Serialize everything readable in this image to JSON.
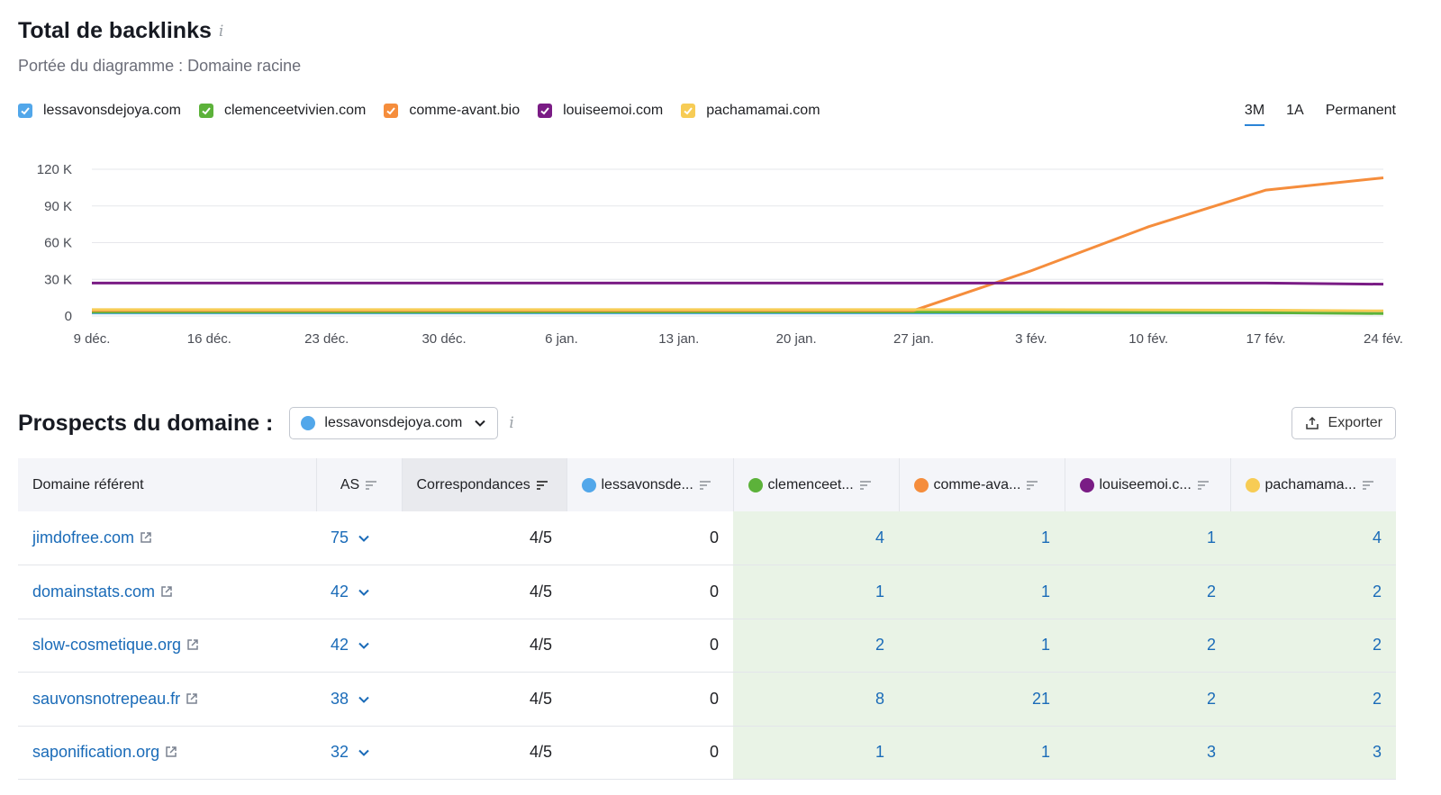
{
  "chart_section": {
    "title": "Total de backlinks",
    "info_glyph": "i",
    "subtitle": "Portée du diagramme : Domaine racine",
    "range_tabs": [
      "3M",
      "1A",
      "Permanent"
    ],
    "active_range": "3M"
  },
  "legend": [
    {
      "label": "lessavonsdejoya.com",
      "color": "#52a7ea"
    },
    {
      "label": "clemenceetvivien.com",
      "color": "#5cb23a"
    },
    {
      "label": "comme-avant.bio",
      "color": "#f58d3c"
    },
    {
      "label": "louiseemoi.com",
      "color": "#7a1c85"
    },
    {
      "label": "pachamamai.com",
      "color": "#f7cc55"
    }
  ],
  "chart_data": {
    "type": "line",
    "title": "Total de backlinks",
    "x": [
      "9 déc.",
      "16 déc.",
      "23 déc.",
      "30 déc.",
      "6 jan.",
      "13 jan.",
      "20 jan.",
      "27 jan.",
      "3 fév.",
      "10 fév.",
      "17 fév.",
      "24 fév."
    ],
    "y_ticks": [
      0,
      30000,
      60000,
      90000,
      120000
    ],
    "y_tick_labels": [
      "0",
      "30 K",
      "60 K",
      "90 K",
      "120 K"
    ],
    "ylim": [
      0,
      120000
    ],
    "grid": true,
    "series": [
      {
        "name": "lessavonsdejoya.com",
        "color": "#52a7ea",
        "values": [
          2500,
          2500,
          2500,
          2500,
          2500,
          2500,
          2500,
          2500,
          2500,
          2500,
          2500,
          2500
        ]
      },
      {
        "name": "clemenceetvivien.com",
        "color": "#5cb23a",
        "values": [
          3200,
          3200,
          3200,
          3200,
          3300,
          3300,
          3300,
          3300,
          3200,
          3000,
          2800,
          2000
        ]
      },
      {
        "name": "comme-avant.bio",
        "color": "#f58d3c",
        "values": [
          4500,
          4500,
          4500,
          4500,
          4500,
          4500,
          4500,
          4500,
          37000,
          73000,
          103000,
          113000
        ]
      },
      {
        "name": "louiseemoi.com",
        "color": "#7a1c85",
        "values": [
          27000,
          27000,
          27000,
          27000,
          27000,
          27000,
          27000,
          27000,
          27000,
          27000,
          27000,
          26000
        ]
      },
      {
        "name": "pachamamai.com",
        "color": "#f7cc55",
        "values": [
          5200,
          5200,
          5200,
          5200,
          5200,
          5200,
          5200,
          5200,
          5200,
          5000,
          4800,
          4200
        ]
      }
    ]
  },
  "prospects": {
    "title": "Prospects du domaine :",
    "selected_domain": "lessavonsdejoya.com",
    "selected_color": "#52a7ea",
    "export_label": "Exporter"
  },
  "table": {
    "headers": {
      "domain": "Domaine référent",
      "as": "AS",
      "matches": "Correspondances",
      "d1": "lessavonsde...",
      "d2": "clemenceet...",
      "d3": "comme-ava...",
      "d4": "louiseemoi.c...",
      "d5": "pachamama..."
    },
    "rows": [
      {
        "domain": "jimdofree.com",
        "as": "75",
        "matches": "4/5",
        "d1": "0",
        "d2": "4",
        "d3": "1",
        "d4": "1",
        "d5": "4"
      },
      {
        "domain": "domainstats.com",
        "as": "42",
        "matches": "4/5",
        "d1": "0",
        "d2": "1",
        "d3": "1",
        "d4": "2",
        "d5": "2"
      },
      {
        "domain": "slow-cosmetique.org",
        "as": "42",
        "matches": "4/5",
        "d1": "0",
        "d2": "2",
        "d3": "1",
        "d4": "2",
        "d5": "2"
      },
      {
        "domain": "sauvonsnotrepeau.fr",
        "as": "38",
        "matches": "4/5",
        "d1": "0",
        "d2": "8",
        "d3": "21",
        "d4": "2",
        "d5": "2"
      },
      {
        "domain": "saponification.org",
        "as": "32",
        "matches": "4/5",
        "d1": "0",
        "d2": "1",
        "d3": "1",
        "d4": "3",
        "d5": "3"
      }
    ]
  }
}
